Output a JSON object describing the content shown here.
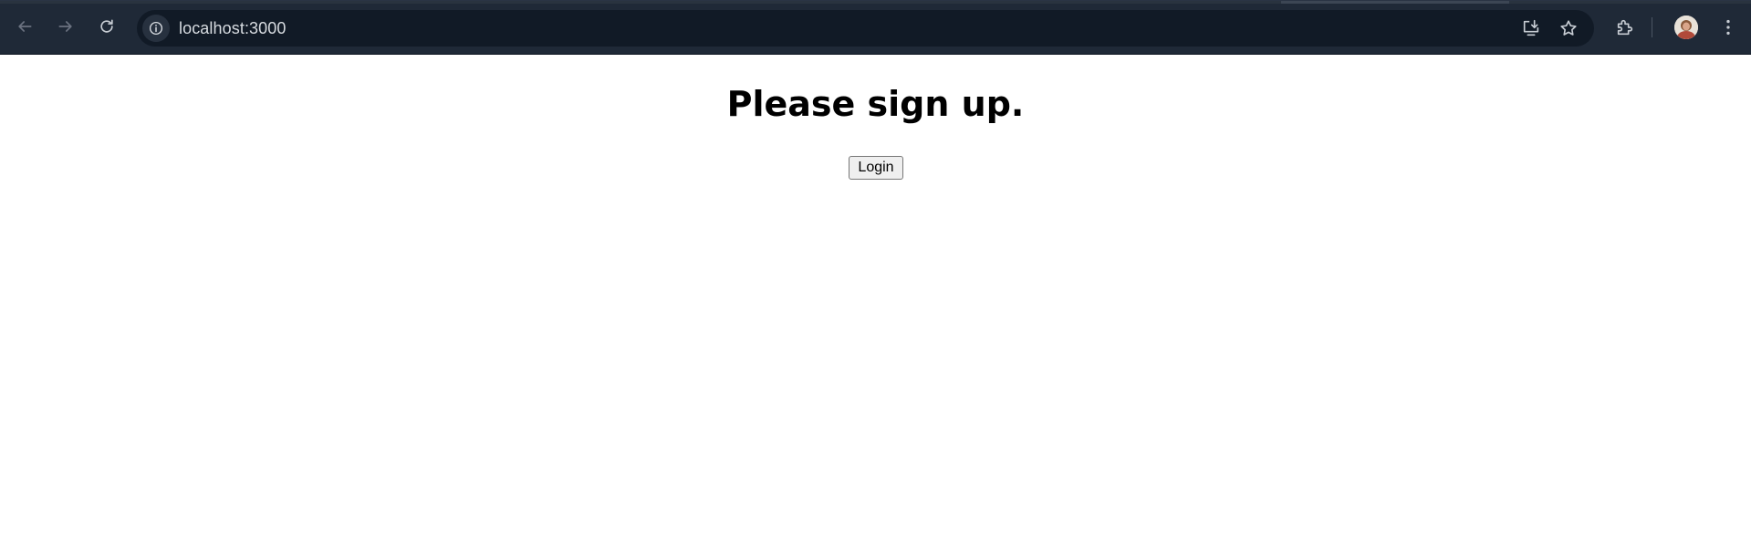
{
  "browser": {
    "url": "localhost:3000",
    "icons": {
      "back": "back-arrow-icon",
      "forward": "forward-arrow-icon",
      "reload": "reload-icon",
      "site_info": "info-icon",
      "install": "install-app-icon",
      "bookmark": "star-icon",
      "extensions": "extensions-puzzle-icon",
      "profile": "profile-avatar",
      "menu": "kebab-menu-icon"
    },
    "colors": {
      "toolbar": "#1f2937",
      "omnibox": "#111a26",
      "icon": "#c7ccd3",
      "icon_disabled": "#6b7280"
    }
  },
  "page": {
    "heading": "Please sign up.",
    "login_button": "Login"
  }
}
